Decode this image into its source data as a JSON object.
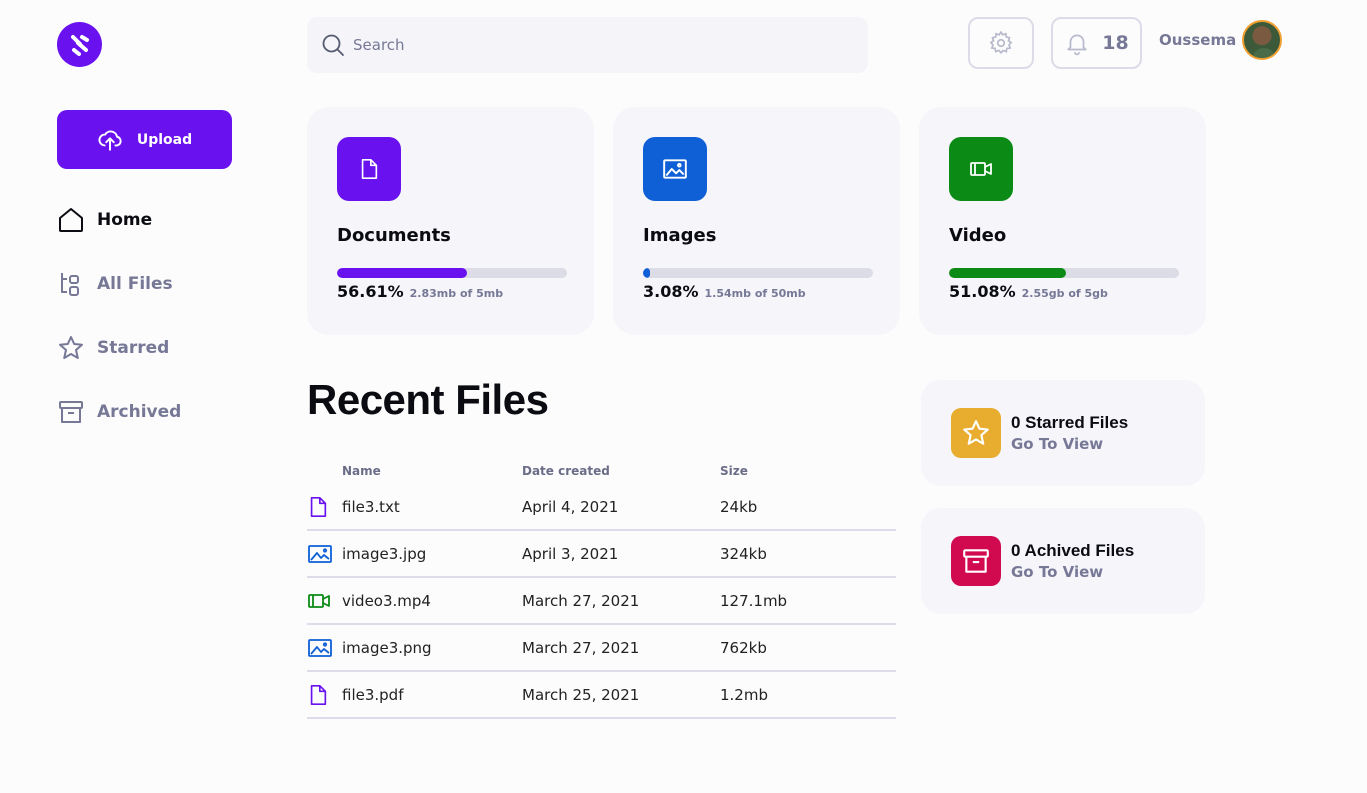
{
  "sidebar": {
    "upload_label": "Upload",
    "items": [
      {
        "label": "Home",
        "icon": "home-icon"
      },
      {
        "label": "All Files",
        "icon": "files-icon"
      },
      {
        "label": "Starred",
        "icon": "star-icon"
      },
      {
        "label": "Archived",
        "icon": "archive-icon"
      }
    ]
  },
  "header": {
    "search_placeholder": "Search",
    "notification_count": "18",
    "user_name": "Oussema"
  },
  "storage": [
    {
      "title": "Documents",
      "percent": "56.61%",
      "usage": "2.83mb of 5mb",
      "fill": 0.5661,
      "color": "#6a11f0"
    },
    {
      "title": "Images",
      "percent": "3.08%",
      "usage": "1.54mb of 50mb",
      "fill": 0.0308,
      "color": "#0f5fd6"
    },
    {
      "title": "Video",
      "percent": "51.08%",
      "usage": "2.55gb of 5gb",
      "fill": 0.5108,
      "color": "#0b8a15"
    }
  ],
  "recent": {
    "title": "Recent Files",
    "columns": [
      "Name",
      "Date created",
      "Size"
    ],
    "rows": [
      {
        "name": "file3.txt",
        "date": "April 4, 2021",
        "size": "24kb",
        "type": "document"
      },
      {
        "name": "image3.jpg",
        "date": "April 3, 2021",
        "size": "324kb",
        "type": "image"
      },
      {
        "name": "video3.mp4",
        "date": "March 27, 2021",
        "size": "127.1mb",
        "type": "video"
      },
      {
        "name": "image3.png",
        "date": "March 27, 2021",
        "size": "762kb",
        "type": "image"
      },
      {
        "name": "file3.pdf",
        "date": "March 25, 2021",
        "size": "1.2mb",
        "type": "document"
      }
    ]
  },
  "summary": {
    "starred": {
      "count_label": "0 Starred Files",
      "link": "Go To View",
      "color": "#e8ac2e"
    },
    "archived": {
      "count_label": "0 Achived Files",
      "link": "Go To View",
      "color": "#d1094f"
    }
  },
  "colors": {
    "accent": "#6a11f0",
    "muted": "#767896"
  }
}
